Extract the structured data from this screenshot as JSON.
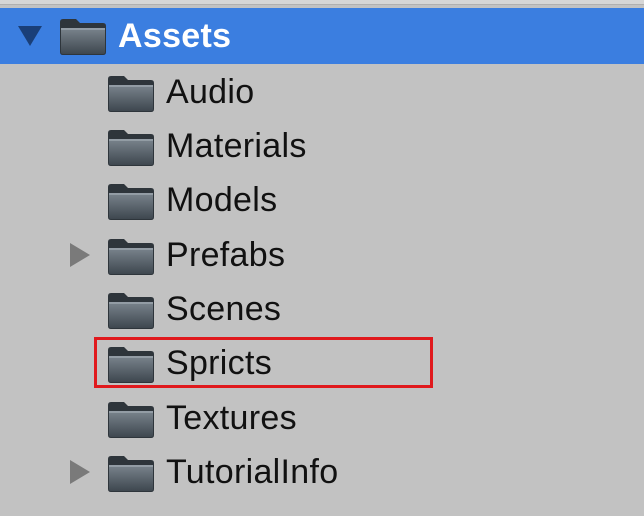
{
  "project_tree": {
    "root": {
      "label": "Assets",
      "expanded": true,
      "selected": true
    },
    "items": [
      {
        "label": "Audio",
        "has_children": false
      },
      {
        "label": "Materials",
        "has_children": false
      },
      {
        "label": "Models",
        "has_children": false
      },
      {
        "label": "Prefabs",
        "has_children": true
      },
      {
        "label": "Scenes",
        "has_children": false
      },
      {
        "label": "Spricts",
        "has_children": false,
        "highlighted": true
      },
      {
        "label": "Textures",
        "has_children": false
      },
      {
        "label": "TutorialInfo",
        "has_children": true
      }
    ]
  },
  "icons": {
    "folder": "folder-icon",
    "expand": "triangle-down-icon",
    "collapse": "triangle-right-icon"
  },
  "colors": {
    "selection": "#3b7ee0",
    "background": "#c2c2c2",
    "highlight_outline": "#e0191d",
    "folder": "#4a5560"
  }
}
